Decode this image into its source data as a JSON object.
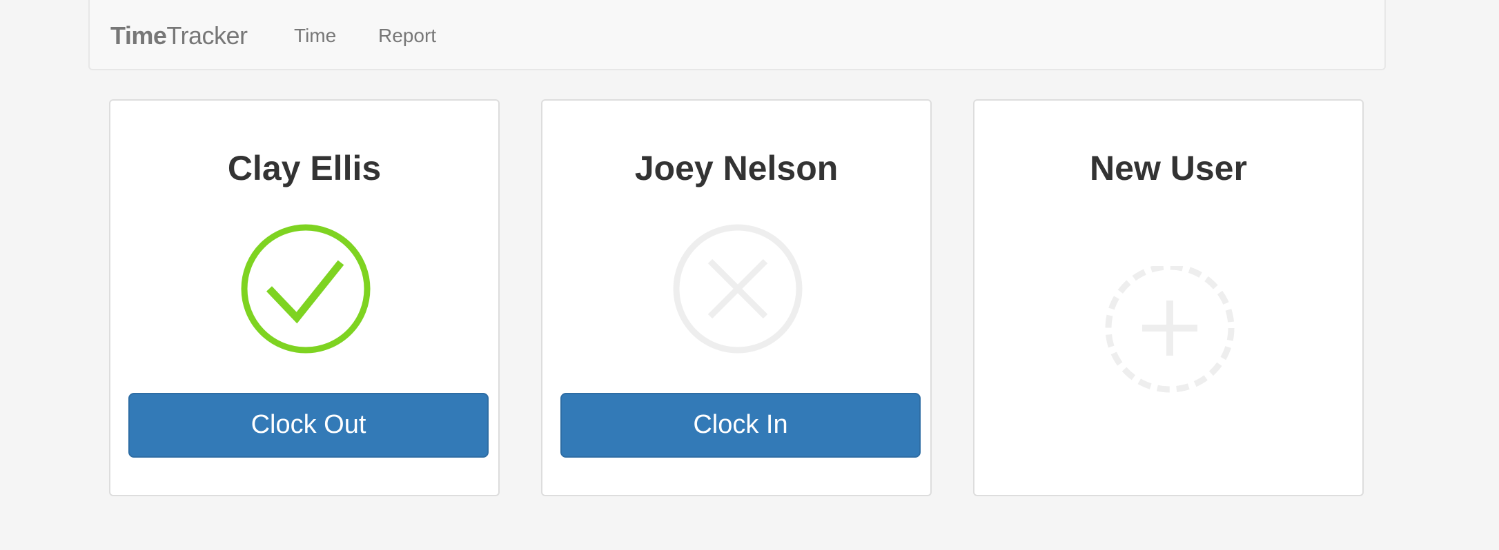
{
  "navbar": {
    "brand_bold": "Time",
    "brand_light": "Tracker",
    "links": [
      {
        "label": "Time"
      },
      {
        "label": "Report"
      }
    ]
  },
  "cards": [
    {
      "name": "Clay Ellis",
      "status_icon": "check-circle-icon",
      "status": "clocked-in",
      "status_color": "#7ed321",
      "button_label": "Clock Out"
    },
    {
      "name": "Joey Nelson",
      "status_icon": "x-circle-icon",
      "status": "clocked-out",
      "status_color": "#eeeeee",
      "button_label": "Clock In"
    },
    {
      "name": "New User",
      "add_icon": "plus-dashed-circle-icon",
      "icon_color": "#eeeeee"
    }
  ],
  "colors": {
    "primary_button": "#337ab7",
    "background": "#f5f5f5",
    "navbar": "#f8f8f8"
  }
}
